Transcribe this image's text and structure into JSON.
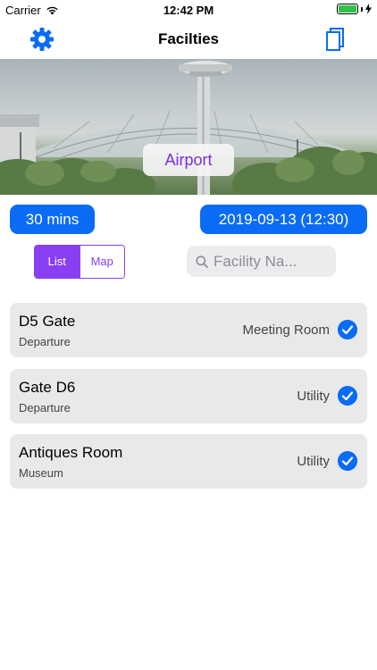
{
  "status_bar": {
    "carrier": "Carrier",
    "time": "12:42 PM"
  },
  "nav": {
    "title": "Facilties"
  },
  "hero": {
    "badge": "Airport"
  },
  "filters": {
    "duration": "30 mins",
    "datetime": "2019-09-13 (12:30)"
  },
  "view_toggle": {
    "list_label": "List",
    "map_label": "Map",
    "selected": "List"
  },
  "search": {
    "placeholder": "Facility Na..."
  },
  "facilities": [
    {
      "name": "D5 Gate",
      "area": "Departure",
      "type": "Meeting Room",
      "checked": true
    },
    {
      "name": "Gate D6",
      "area": "Departure",
      "type": "Utility",
      "checked": true
    },
    {
      "name": "Antiques Room",
      "area": "Museum",
      "type": "Utility",
      "checked": true
    }
  ],
  "colors": {
    "accent_blue": "#0a6cf5",
    "accent_purple": "#8a3ff2",
    "badge_text": "#7a2fe0"
  }
}
